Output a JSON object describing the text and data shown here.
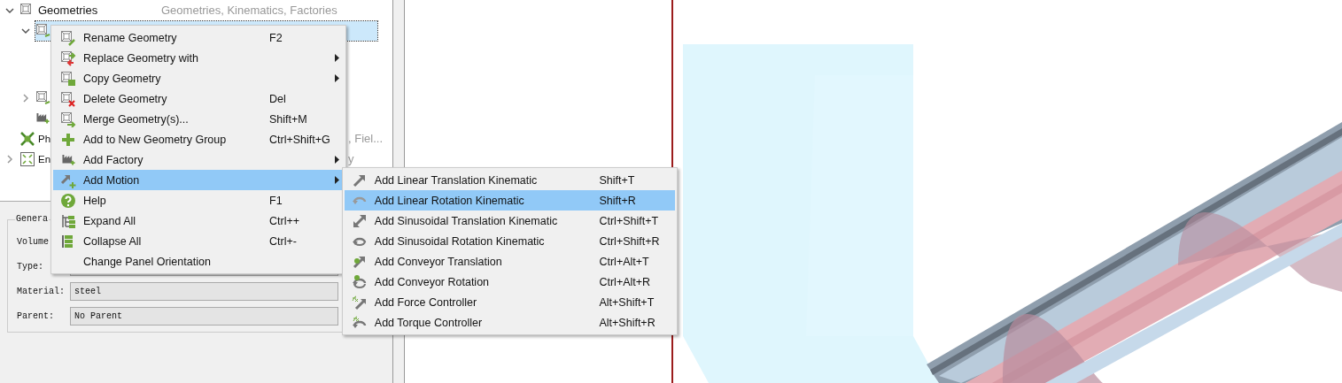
{
  "tree": {
    "items": [
      {
        "label": "Geometries",
        "description": "Geometries, Kinematics, Factories",
        "kind": "geometry",
        "expanded": true,
        "selected": false,
        "children": [
          {
            "kind": "geometry-sub",
            "expanded": true,
            "selected": true
          },
          {
            "kind": "geometry-sub",
            "expanded": false,
            "selected": false
          },
          {
            "kind": "factory",
            "selected": false
          }
        ]
      },
      {
        "label": "Ph",
        "description": ", Fiel...",
        "kind": "physics",
        "selected": false
      },
      {
        "label": "En",
        "description": "y",
        "kind": "environment",
        "expanded": false,
        "selected": false
      }
    ]
  },
  "properties": {
    "group_title": "Genera",
    "fields": [
      {
        "label": "Volume",
        "kind": "label"
      },
      {
        "label": "Type:",
        "kind": "field"
      },
      {
        "label": "Material:",
        "value": "steel",
        "kind": "field"
      },
      {
        "label": "Parent:",
        "value": "No Parent",
        "kind": "field"
      }
    ]
  },
  "context_menu": {
    "items": [
      {
        "label": "Rename Geometry",
        "shortcut": "F2",
        "kind": "rename",
        "submenu": false,
        "selected": false
      },
      {
        "label": "Replace Geometry with",
        "kind": "replace",
        "submenu": true,
        "selected": false
      },
      {
        "label": "Copy Geometry",
        "kind": "copy",
        "submenu": true,
        "selected": false
      },
      {
        "label": "Delete Geometry",
        "shortcut": "Del",
        "kind": "delete",
        "submenu": false,
        "selected": false
      },
      {
        "label": "Merge Geometry(s)...",
        "shortcut": "Shift+M",
        "kind": "merge",
        "submenu": false,
        "selected": false
      },
      {
        "label": "Add to New Geometry Group",
        "shortcut": "Ctrl+Shift+G",
        "kind": "add",
        "submenu": false,
        "selected": false
      },
      {
        "label": "Add Factory",
        "kind": "factory",
        "submenu": true,
        "selected": false
      },
      {
        "label": "Add Motion",
        "kind": "motion",
        "submenu": true,
        "selected": true
      },
      {
        "label": "Help",
        "shortcut": "F1",
        "kind": "help",
        "submenu": false,
        "selected": false
      },
      {
        "label": "Expand All",
        "shortcut": "Ctrl++",
        "kind": "expand",
        "submenu": false,
        "selected": false
      },
      {
        "label": "Collapse All",
        "shortcut": "Ctrl+-",
        "kind": "collapse",
        "submenu": false,
        "selected": false
      },
      {
        "label": "Change Panel Orientation",
        "kind": "none",
        "submenu": false,
        "selected": false
      }
    ]
  },
  "submenu": {
    "items": [
      {
        "label": "Add Linear Translation Kinematic",
        "shortcut": "Shift+T",
        "kind": "translate",
        "selected": false
      },
      {
        "label": "Add Linear Rotation Kinematic",
        "shortcut": "Shift+R",
        "kind": "rotate",
        "selected": true
      },
      {
        "label": "Add Sinusoidal Translation Kinematic",
        "shortcut": "Ctrl+Shift+T",
        "kind": "sin-translate",
        "selected": false
      },
      {
        "label": "Add Sinusoidal Rotation Kinematic",
        "shortcut": "Ctrl+Shift+R",
        "kind": "sin-rotate",
        "selected": false
      },
      {
        "label": "Add Conveyor Translation",
        "shortcut": "Ctrl+Alt+T",
        "kind": "conveyor-translate",
        "selected": false
      },
      {
        "label": "Add Conveyor Rotation",
        "shortcut": "Ctrl+Alt+R",
        "kind": "conveyor-rotate",
        "selected": false
      },
      {
        "label": "Add Force Controller",
        "shortcut": "Alt+Shift+T",
        "kind": "force",
        "selected": false
      },
      {
        "label": "Add Torque Controller",
        "shortcut": "Alt+Shift+R",
        "kind": "torque",
        "selected": false
      }
    ]
  }
}
